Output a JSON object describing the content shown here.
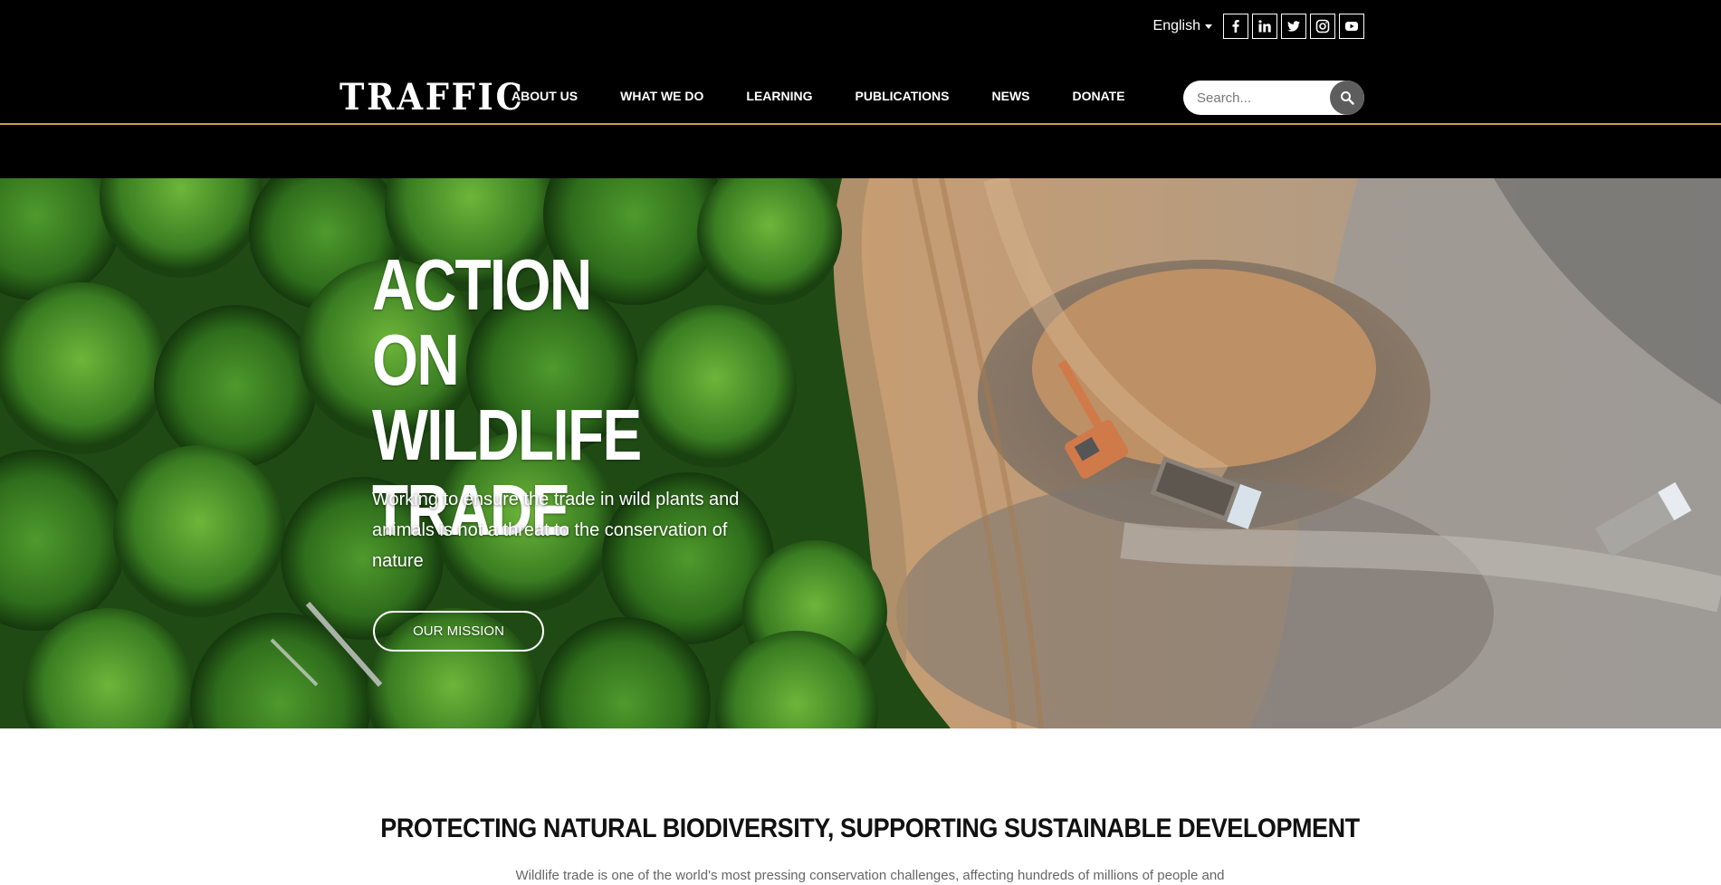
{
  "header": {
    "language": "English",
    "social": [
      {
        "name": "facebook"
      },
      {
        "name": "linkedin"
      },
      {
        "name": "twitter"
      },
      {
        "name": "instagram"
      },
      {
        "name": "youtube"
      }
    ],
    "logo_text": "TRAFFIC",
    "nav": [
      "ABOUT US",
      "WHAT WE DO",
      "LEARNING",
      "PUBLICATIONS",
      "NEWS",
      "DONATE"
    ],
    "search": {
      "placeholder": "Search..."
    },
    "accent_color": "#c9a04c"
  },
  "hero": {
    "title_lines": [
      "ACTION ON",
      "WILDLIFE",
      "TRADE"
    ],
    "subtitle": "Working to ensure the trade in wild plants and animals is not a threat to the conservation of nature",
    "button_label": "OUR MISSION"
  },
  "section": {
    "title": "PROTECTING NATURAL BIODIVERSITY, SUPPORTING SUSTAINABLE DEVELOPMENT",
    "text": "Wildlife trade is one of the world's most pressing conservation challenges, affecting hundreds of millions of people and"
  }
}
